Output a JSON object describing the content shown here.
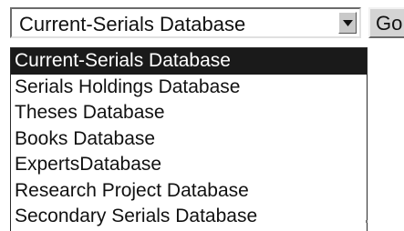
{
  "select": {
    "value": "Current-Serials Database",
    "arrow_icon": "chevron-down-icon"
  },
  "go_button": {
    "label": "Go"
  },
  "dropdown": {
    "selected_index": 0,
    "options": [
      "Current-Serials Database",
      "Serials Holdings Database",
      "Theses Database",
      "Books Database",
      "ExpertsDatabase",
      "Research Project Database",
      "Secondary Serials Database"
    ]
  },
  "colors": {
    "selected_bg": "#1a1a1a",
    "selected_fg": "#ffffff",
    "button_face": "#d4d4d4"
  }
}
